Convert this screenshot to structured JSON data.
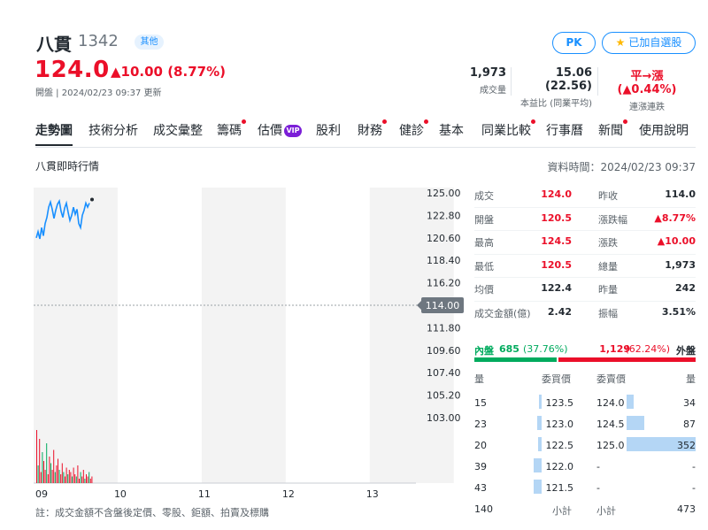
{
  "header": {
    "name": "八貫",
    "code": "1342",
    "market_badge": "其他",
    "pk_label": "PK",
    "watchlist_label": "已加自選股",
    "price": "124.0",
    "change": "▲10.00 (8.77%)",
    "status": "開盤 | 2024/02/23 09:37 更新",
    "stats": {
      "volume_value": "1,973",
      "volume_label": "成交量",
      "pe_value": "15.06 (22.56)",
      "pe_label": "本益比 (同業平均)",
      "streak_value_prefix": "平→漲 (",
      "streak_value_pct": "▲0.44%",
      "streak_value_suffix": ")",
      "streak_label": "連漲連跌"
    }
  },
  "tabs": [
    {
      "label": "走勢圖",
      "active": true,
      "dot": false
    },
    {
      "label": "技術分析",
      "dot": false
    },
    {
      "label": "成交彙整",
      "dot": false
    },
    {
      "label": "籌碼",
      "dot": true
    },
    {
      "label": "估價",
      "dot": false,
      "vip": "VIP"
    },
    {
      "label": "股利",
      "dot": false
    },
    {
      "label": "財務",
      "dot": true
    },
    {
      "label": "健診",
      "dot": true
    },
    {
      "label": "基本",
      "dot": false
    },
    {
      "label": "同業比較",
      "dot": true
    },
    {
      "label": "行事曆",
      "dot": false
    },
    {
      "label": "新聞",
      "dot": true
    },
    {
      "label": "使用說明",
      "dot": false
    }
  ],
  "section_title": "八貫即時行情",
  "data_time": "資料時間：2024/02/23 09:37",
  "footnote": "註：成交金額不含盤後定價、零股、鉅額、拍賣及標購",
  "chart_data": {
    "type": "line",
    "x_ticks": [
      "09",
      "10",
      "11",
      "12",
      "13"
    ],
    "y_ticks": [
      "125.00",
      "122.80",
      "120.60",
      "118.40",
      "116.20",
      "114.00",
      "111.80",
      "109.60",
      "107.40",
      "105.20",
      "103.00"
    ],
    "ylim": [
      103.0,
      125.0
    ],
    "reference_price": "114.00",
    "price_series": [
      120.6,
      121.2,
      120.5,
      121.6,
      120.8,
      122.0,
      122.6,
      123.6,
      124.1,
      123.4,
      122.5,
      123.3,
      123.9,
      124.2,
      123.2,
      122.6,
      123.5,
      124.0,
      123.1,
      122.3,
      122.8,
      123.6,
      122.9,
      123.4,
      122.0,
      121.6,
      122.8,
      123.3,
      124.0,
      123.6,
      124.0
    ],
    "volume_series": [
      24,
      8,
      20,
      5,
      14,
      10,
      6,
      18,
      4,
      12,
      9,
      6,
      15,
      5,
      8,
      11,
      6,
      4,
      9,
      5,
      3,
      7,
      4,
      6,
      5,
      3,
      7,
      4,
      3,
      8,
      2,
      5,
      3,
      6,
      2,
      4,
      3,
      5,
      2,
      3
    ]
  },
  "quote": [
    {
      "l1": "成交",
      "v1": "124.0",
      "c1": "red",
      "l2": "昨收",
      "v2": "114.0",
      "c2": ""
    },
    {
      "l1": "開盤",
      "v1": "120.5",
      "c1": "red",
      "l2": "漲跌幅",
      "v2": "▲8.77%",
      "c2": "red"
    },
    {
      "l1": "最高",
      "v1": "124.5",
      "c1": "red",
      "l2": "漲跌",
      "v2": "▲10.00",
      "c2": "red"
    },
    {
      "l1": "最低",
      "v1": "120.5",
      "c1": "red",
      "l2": "總量",
      "v2": "1,973",
      "c2": ""
    },
    {
      "l1": "均價",
      "v1": "122.4",
      "c1": "",
      "l2": "昨量",
      "v2": "242",
      "c2": ""
    },
    {
      "l1": "成交金額(億)",
      "v1": "2.42",
      "c1": "",
      "l2": "振幅",
      "v2": "3.51%",
      "c2": ""
    }
  ],
  "inout": {
    "inner_label": "內盤",
    "inner_value": "685",
    "inner_pct": "(37.76%)",
    "inner_ratio": 0.3776,
    "outer_value": "1,129",
    "outer_pct": "(62.24%)",
    "outer_label": "外盤"
  },
  "orderbook_headers": {
    "bid_qty": "量",
    "bid_price": "委買價",
    "ask_price": "委賣價",
    "ask_qty": "量"
  },
  "orderbook": [
    {
      "bid_qty": "15",
      "bid_price": "123.5",
      "ask_price": "124.0",
      "ask_qty": "34",
      "bid_ratio": 0.04,
      "ask_ratio": 0.1
    },
    {
      "bid_qty": "23",
      "bid_price": "123.0",
      "ask_price": "124.5",
      "ask_qty": "87",
      "bid_ratio": 0.06,
      "ask_ratio": 0.25
    },
    {
      "bid_qty": "20",
      "bid_price": "122.5",
      "ask_price": "125.0",
      "ask_qty": "352",
      "bid_ratio": 0.05,
      "ask_ratio": 1.0
    },
    {
      "bid_qty": "39",
      "bid_price": "122.0",
      "ask_price": "-",
      "ask_qty": "-",
      "bid_ratio": 0.11,
      "ask_ratio": 0
    },
    {
      "bid_qty": "43",
      "bid_price": "121.5",
      "ask_price": "-",
      "ask_qty": "-",
      "bid_ratio": 0.12,
      "ask_ratio": 0
    }
  ],
  "orderbook_total": {
    "bid_total": "140",
    "bid_label": "小計",
    "ask_label": "小計",
    "ask_total": "473"
  }
}
